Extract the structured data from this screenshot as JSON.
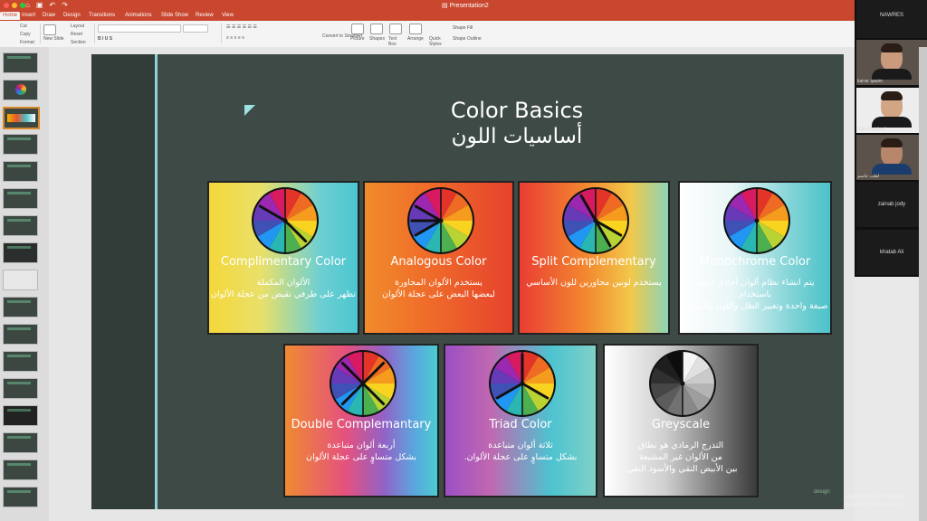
{
  "app": {
    "document_title": "Presentation2",
    "tabs": [
      "Home",
      "Insert",
      "Draw",
      "Design",
      "Transitions",
      "Animations",
      "Slide Show",
      "Review",
      "View"
    ],
    "active_tab": "Home",
    "ribbon": {
      "cut": "Cut",
      "copy": "Copy",
      "format": "Format",
      "new_slide": "New Slide",
      "layout": "Layout",
      "reset": "Reset",
      "section": "Section",
      "convert": "Convert to SmartArt",
      "picture": "Picture",
      "shapes": "Shapes",
      "text_box": "Text Box",
      "arrange": "Arrange",
      "quick_styles": "Quick Styles",
      "shape_fill": "Shape Fill",
      "shape_outline": "Shape Outline"
    }
  },
  "slide": {
    "title_en": "Color Basics",
    "title_ar": "أساسيات اللون",
    "cards": [
      {
        "title": "Complimentary Color",
        "desc_lines": [
          "الألوان المكملة",
          "تظهر على طرفي نقيض من عجلة الألوان"
        ],
        "style": "complimentary"
      },
      {
        "title": "Analogous Color",
        "desc_lines": [
          "يستخدم الألوان المجاورة",
          "لبعضها البعض على عجلة الألوان"
        ],
        "style": "analogous"
      },
      {
        "title": "Split Complementary",
        "desc_lines": [
          "يستخدم لونين مجاورين للون الأساسي"
        ],
        "style": "split"
      },
      {
        "title": "Monochrome Color",
        "desc_lines": [
          "يتم انشاء نظام ألوان أحادي اللون باستخدام",
          "صبغة واحدة وتغيير الظل واللون والصبغة."
        ],
        "style": "mono"
      },
      {
        "title": "Double Complemantary",
        "desc_lines": [
          "أربعة ألوان متباعدة",
          "بشكل متساوٍ على عجلة الألوان"
        ],
        "style": "double"
      },
      {
        "title": "Triad Color",
        "desc_lines": [
          "ثلاثة ألوان متباعدة",
          "بشكل متساوٍ على عجلة الألوان."
        ],
        "style": "triad"
      },
      {
        "title": "Greyscale",
        "desc_lines": [
          "التدرج الرمادي هو نطاق",
          "من الألوان غير المشبعة",
          "بين الأبيض النقي والأسود النقي."
        ],
        "style": "grey"
      }
    ],
    "brand_text": "design",
    "cert_line1": "CERTIFIED TRAINER",
    "cert_line2": "DAVINCI RESOLVE 17"
  },
  "participants": [
    {
      "name": "NAWRES",
      "video": false
    },
    {
      "name": "karrar qasim",
      "video": true
    },
    {
      "name": "Bakr Mujahed",
      "video": true
    },
    {
      "name": "لعلب جاسم",
      "video": true
    },
    {
      "name": "zainab jody",
      "video": false
    },
    {
      "name": "khatab Ali",
      "video": false
    }
  ],
  "colors": {
    "accent_orange": "#c8472e",
    "slide_bg": "#3e4a45",
    "slide_accent_line": "#8fd3d6"
  }
}
